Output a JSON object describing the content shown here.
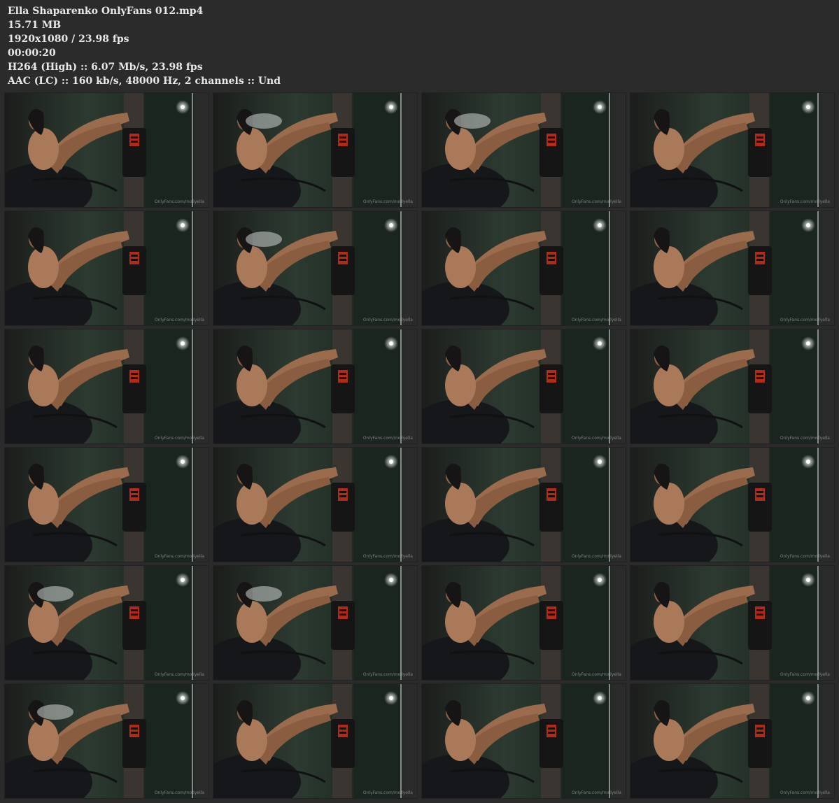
{
  "info": {
    "filename": "Ella Shaparenko OnlyFans 012.mp4",
    "filesize": "15.71 MB",
    "resolution_fps": "1920x1080 / 23.98 fps",
    "duration": "00:00:20",
    "video_stream": "H264 (High) :: 6.07 Mb/s, 23.98 fps",
    "audio_stream": "AAC (LC) :: 160 kb/s, 48000 Hz, 2 channels :: Und"
  },
  "watermark": "OnlyFans.com/mollyella",
  "thumbnails": [
    {
      "smoke": false
    },
    {
      "smoke": true
    },
    {
      "smoke": true
    },
    {
      "smoke": false
    },
    {
      "smoke": false
    },
    {
      "smoke": true
    },
    {
      "smoke": false
    },
    {
      "smoke": false
    },
    {
      "smoke": false
    },
    {
      "smoke": false
    },
    {
      "smoke": false
    },
    {
      "smoke": false
    },
    {
      "smoke": false
    },
    {
      "smoke": false
    },
    {
      "smoke": false
    },
    {
      "smoke": false
    },
    {
      "smoke": true
    },
    {
      "smoke": true
    },
    {
      "smoke": false
    },
    {
      "smoke": false
    },
    {
      "smoke": true
    },
    {
      "smoke": false
    },
    {
      "smoke": false
    },
    {
      "smoke": false
    }
  ]
}
